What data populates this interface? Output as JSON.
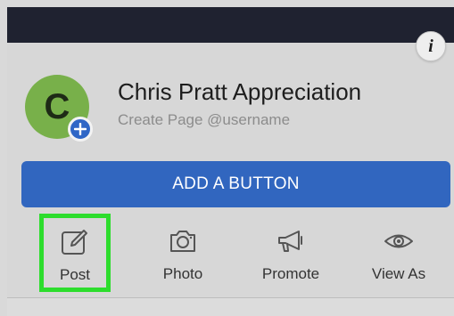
{
  "page": {
    "title": "Chris Pratt Appreciation",
    "subtitle": "Create Page @username",
    "avatar_letter": "C"
  },
  "info_button": {
    "label": "i",
    "icon": "info-icon"
  },
  "primary_action": {
    "label": "ADD A BUTTON"
  },
  "actions": [
    {
      "label": "Post",
      "icon": "edit-icon",
      "highlighted": true
    },
    {
      "label": "Photo",
      "icon": "camera-icon"
    },
    {
      "label": "Promote",
      "icon": "megaphone-icon"
    },
    {
      "label": "View As",
      "icon": "eye-icon"
    }
  ],
  "colors": {
    "accent_blue": "#3166bf",
    "avatar_green": "#78b04a",
    "highlight_green": "#2ddd2d",
    "topbar": "#1f2230"
  }
}
